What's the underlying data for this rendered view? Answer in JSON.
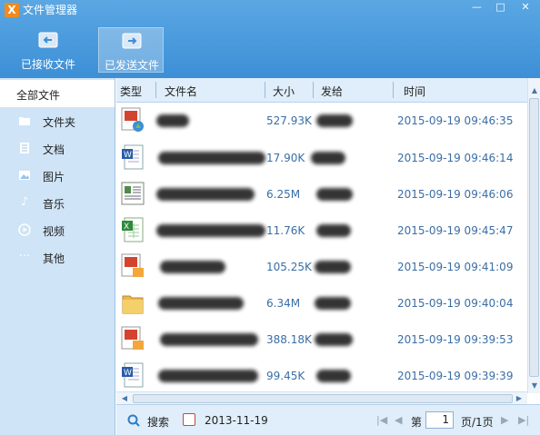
{
  "window": {
    "title": "文件管理器",
    "logo_glyph": "X",
    "minimize_glyph": "—",
    "maximize_glyph": "□",
    "close_glyph": "✕"
  },
  "toolbar": {
    "received_label": "已接收文件",
    "sent_label": "已发送文件",
    "active_tab": "sent"
  },
  "sidebar": {
    "items": [
      {
        "label": "全部文件",
        "icon": "all-files",
        "active": true
      },
      {
        "label": "文件夹",
        "icon": "folder-icon"
      },
      {
        "label": "文档",
        "icon": "document-icon"
      },
      {
        "label": "图片",
        "icon": "picture-icon"
      },
      {
        "label": "音乐",
        "icon": "music-icon"
      },
      {
        "label": "视频",
        "icon": "video-icon"
      },
      {
        "label": "其他",
        "icon": "more-icon"
      }
    ]
  },
  "table": {
    "columns": {
      "type": "类型",
      "name": "文件名",
      "size": "大小",
      "sender": "发给",
      "time": "时间"
    },
    "rows": [
      {
        "icon": "ppt-image-icon",
        "size": "527.93K",
        "time": "2015-09-19 09:46:35"
      },
      {
        "icon": "word-doc-icon",
        "size": "17.90K",
        "time": "2015-09-19 09:46:14"
      },
      {
        "icon": "generic-doc-icon",
        "size": "6.25M",
        "time": "2015-09-19 09:46:06"
      },
      {
        "icon": "excel-doc-icon",
        "size": "11.76K",
        "time": "2015-09-19 09:45:47"
      },
      {
        "icon": "ppt-image-icon",
        "size": "105.25K",
        "time": "2015-09-19 09:41:09"
      },
      {
        "icon": "folder-file-icon",
        "size": "6.34M",
        "time": "2015-09-19 09:40:04"
      },
      {
        "icon": "ppt-image-icon",
        "size": "388.18K",
        "time": "2015-09-19 09:39:53"
      },
      {
        "icon": "word-doc-icon",
        "size": "99.45K",
        "time": "2015-09-19 09:39:39"
      }
    ]
  },
  "footer": {
    "search_label": "搜索",
    "date": "2013-11-19",
    "page_prefix": "第",
    "page_value": "1",
    "page_suffix": "页/1页",
    "first_glyph": "|◀",
    "prev_glyph": "◀",
    "next_glyph": "▶",
    "last_glyph": "▶|"
  },
  "colors": {
    "title_bar": "#4a9bdc",
    "sidebar_bg": "#cfe4f6",
    "header_bg": "#dfeefa",
    "link_text": "#3a6ea5"
  }
}
